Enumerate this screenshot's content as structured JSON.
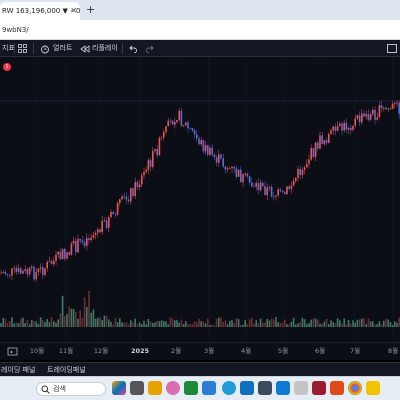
{
  "browser": {
    "tab_title": "RW 163,196,000 ▼ −0.1...",
    "tab_close": "×",
    "new_tab": "+",
    "url": "9wbN3/"
  },
  "toolbar": {
    "indicators_label": "지표",
    "alert_label": "얼러트",
    "replay_label": "리플레이"
  },
  "chart": {
    "x_ticks": [
      "10월",
      "11월",
      "12월",
      "2025",
      "2월",
      "3월",
      "4월",
      "5월",
      "6월",
      "7월",
      "8월"
    ],
    "notification_count": "1",
    "colors": {
      "up": "#ef5350",
      "down": "#5b6bdc",
      "volume_up": "#3a7a66",
      "volume_down": "#6b2f33"
    }
  },
  "panel": {
    "tab1": "레이딩 패널",
    "tab2": "트레이딩패널"
  },
  "taskbar": {
    "search_placeholder": "검색"
  },
  "chart_data": {
    "type": "line",
    "x": [
      "10월",
      "11월",
      "12월",
      "2025",
      "2월",
      "3월",
      "4월",
      "5월",
      "6월",
      "7월",
      "8월"
    ],
    "series": [
      {
        "values": [
          12,
          22,
          34,
          58,
          92,
          72,
          58,
          50,
          78,
          88,
          95
        ]
      }
    ],
    "ylim": [
      0,
      100
    ]
  }
}
